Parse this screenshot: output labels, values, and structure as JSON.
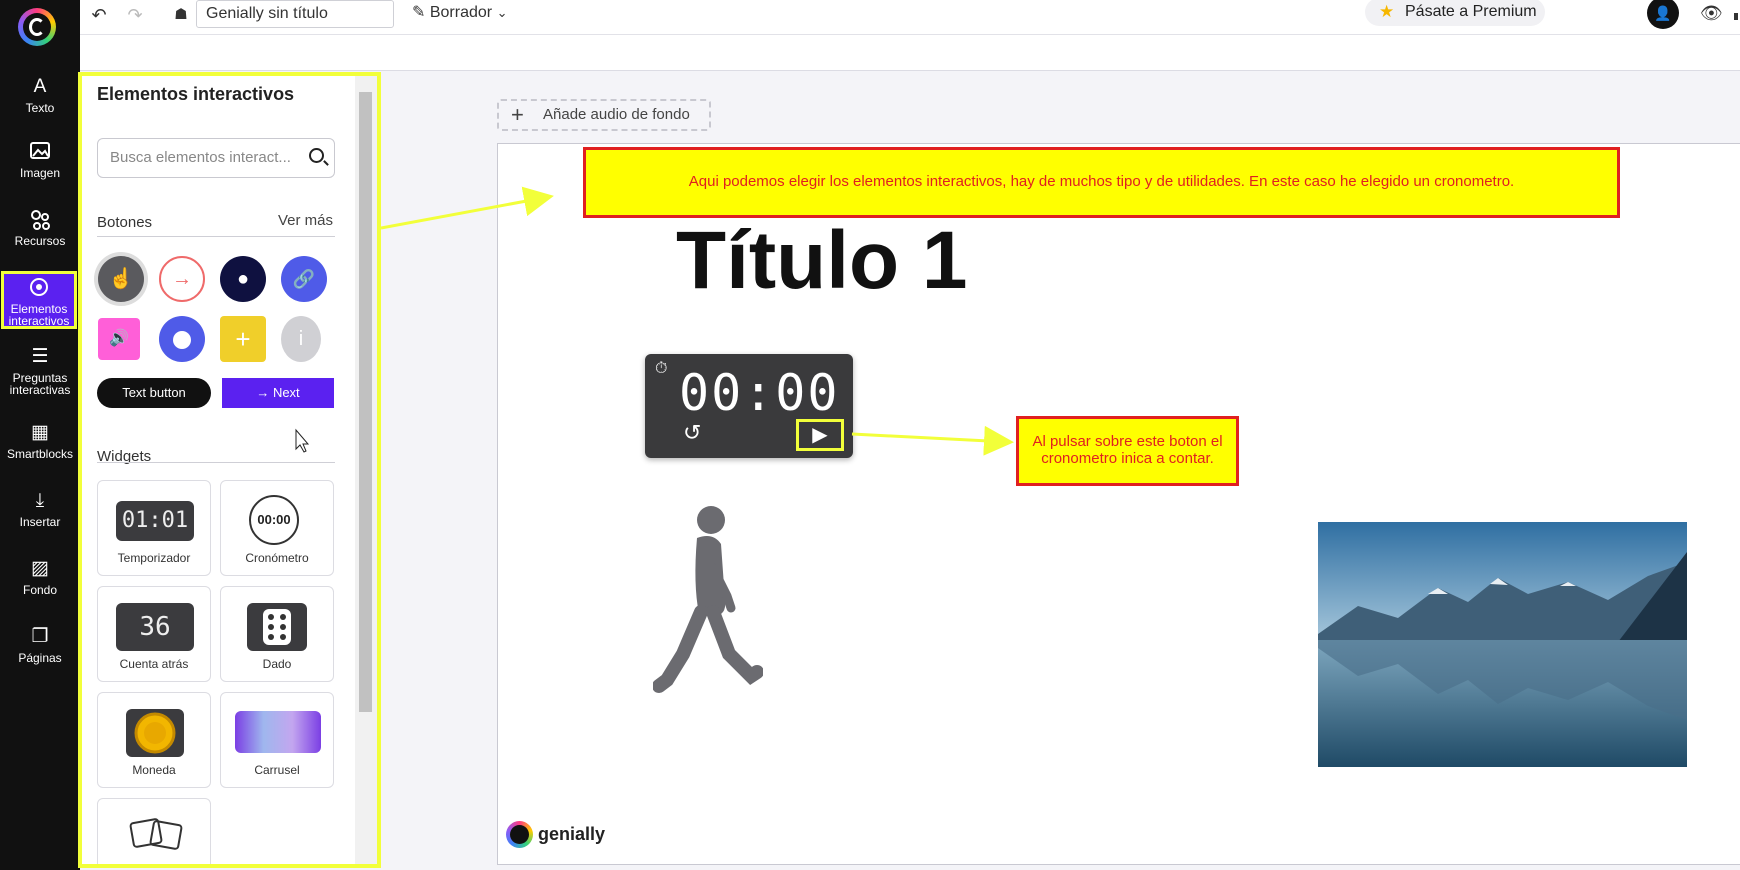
{
  "topbar": {
    "doc_title": "Genially sin título",
    "draft_label": "Borrador",
    "premium_label": "Pásate a Premium"
  },
  "rail": {
    "items": [
      {
        "label": "Texto",
        "icon": "text-icon"
      },
      {
        "label": "Imagen",
        "icon": "image-icon"
      },
      {
        "label": "Recursos",
        "icon": "resources-icon"
      },
      {
        "label": "Elementos interactivos",
        "icon": "interactive-icon"
      },
      {
        "label": "Preguntas interactivas",
        "icon": "questions-icon"
      },
      {
        "label": "Smartblocks",
        "icon": "smartblocks-icon"
      },
      {
        "label": "Insertar",
        "icon": "insert-icon"
      },
      {
        "label": "Fondo",
        "icon": "background-icon"
      },
      {
        "label": "Páginas",
        "icon": "pages-icon"
      }
    ]
  },
  "panel": {
    "title": "Elementos interactivos",
    "search_placeholder": "Busca elementos interact...",
    "buttons_heading": "Botones",
    "see_more": "Ver más",
    "text_button": "Text button",
    "next_button": "Next",
    "widgets_heading": "Widgets",
    "widgets": [
      {
        "label": "Temporizador",
        "thumb_text": "01:01"
      },
      {
        "label": "Cronómetro",
        "thumb_text": "00:00"
      },
      {
        "label": "Cuenta atrás",
        "thumb_text": "36"
      },
      {
        "label": "Dado",
        "thumb_text": ""
      },
      {
        "label": "Moneda",
        "thumb_text": ""
      },
      {
        "label": "Carrusel",
        "thumb_text": ""
      }
    ]
  },
  "canvas": {
    "audio_label": "Añade audio de fondo",
    "note_top": "Aqui podemos elegir los elementos interactivos, hay de muchos tipo y de utilidades. En este caso he elegido un cronometro.",
    "note_play": "Al pulsar sobre este boton el cronometro inica a contar.",
    "title": "Título 1",
    "chrono_time": "00:00",
    "brand": "genially"
  },
  "colors": {
    "accent": "#5b21f0",
    "highlight": "#f2ff3a",
    "note_bg": "#ffff00",
    "note_text": "#e02020"
  }
}
